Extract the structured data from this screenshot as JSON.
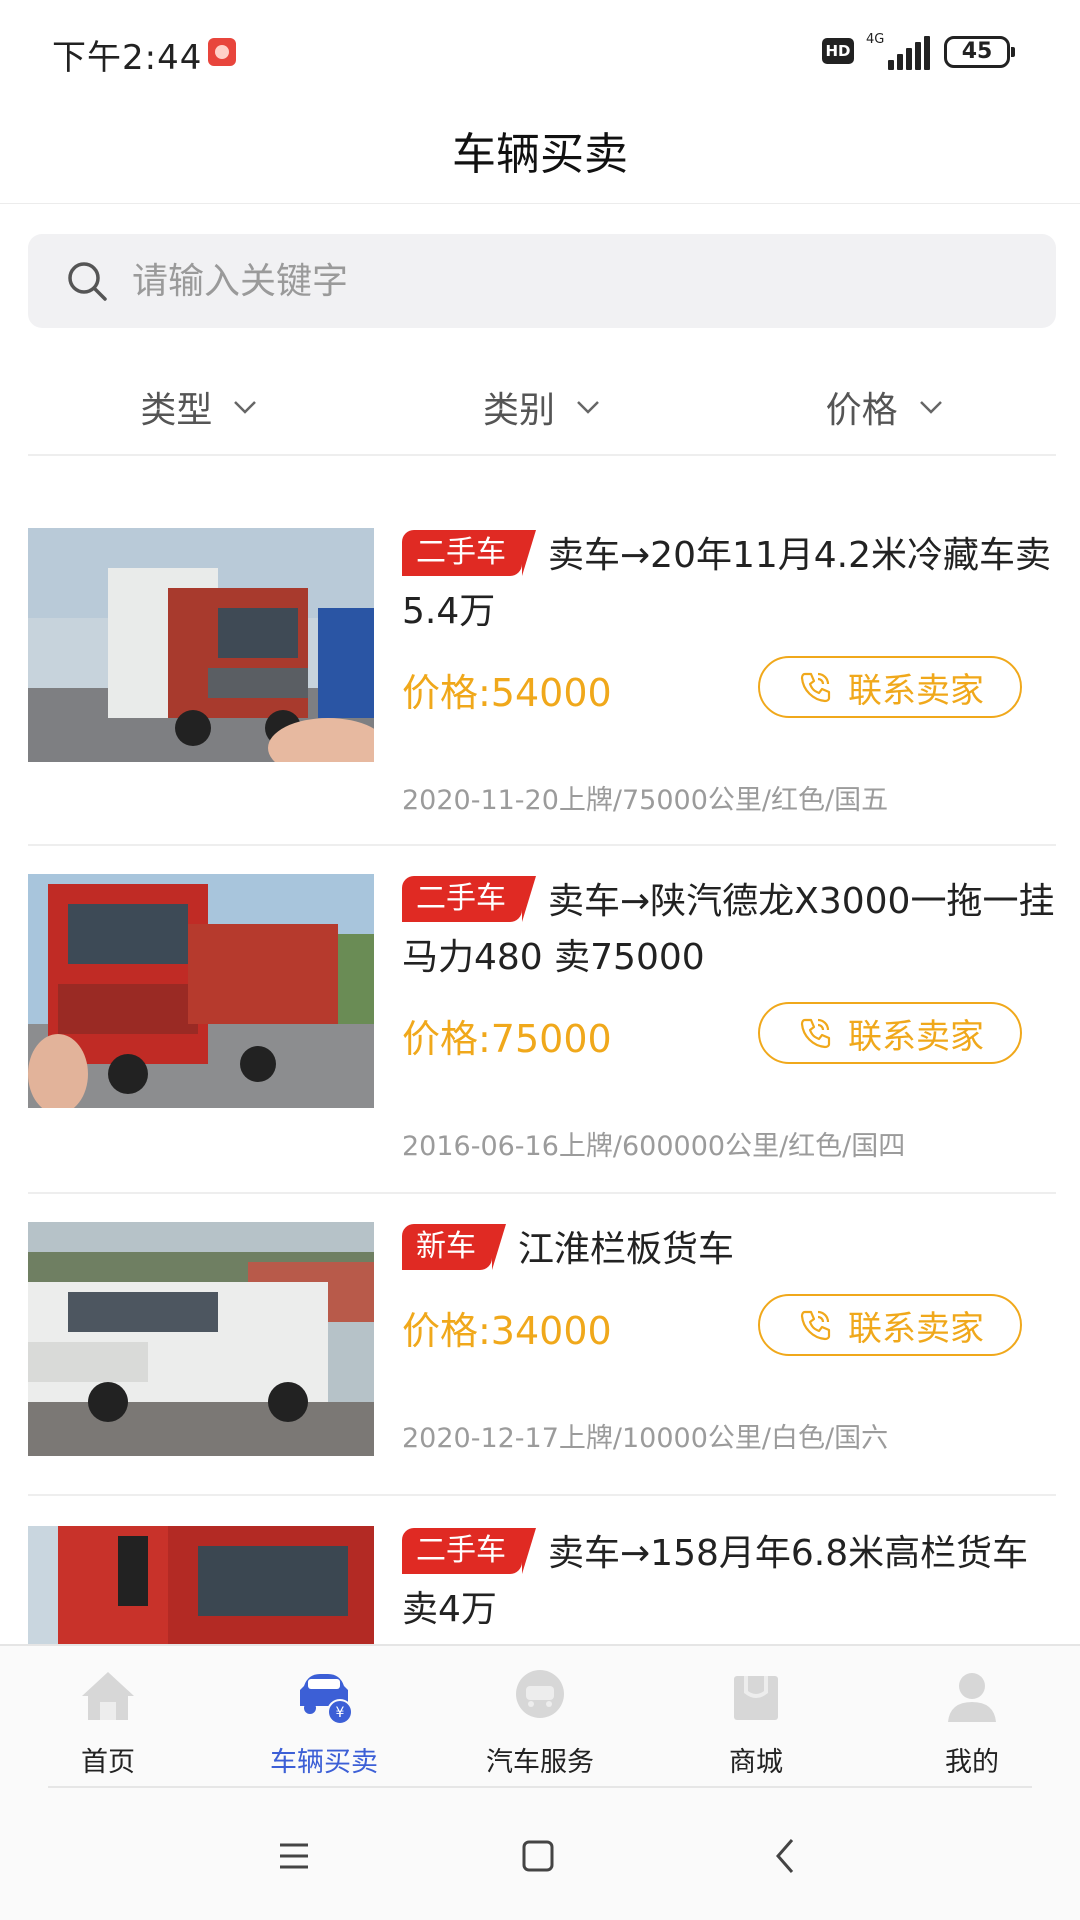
{
  "status_bar": {
    "time": "下午2:44",
    "network": "4G",
    "battery": "45",
    "hd_label": "HD"
  },
  "header": {
    "title": "车辆买卖"
  },
  "search": {
    "placeholder": "请输入关键字"
  },
  "filters": [
    {
      "label": "类型"
    },
    {
      "label": "类别"
    },
    {
      "label": "价格"
    }
  ],
  "listings": [
    {
      "tag": "二手车",
      "title": "卖车→20年11月4.2米冷藏车卖5.4万",
      "price": "价格:54000",
      "contact": "联系卖家",
      "meta": "2020-11-20上牌/75000公里/红色/国五"
    },
    {
      "tag": "二手车",
      "title": "卖车→陕汽德龙X3000一拖一挂 马力480 卖75000",
      "price": "价格:75000",
      "contact": "联系卖家",
      "meta": "2016-06-16上牌/600000公里/红色/国四"
    },
    {
      "tag": "新车",
      "title": "江淮栏板货车",
      "price": "价格:34000",
      "contact": "联系卖家",
      "meta": "2020-12-17上牌/10000公里/白色/国六"
    },
    {
      "tag": "二手车",
      "title": "卖车→158月年6.8米高栏货车卖4万"
    }
  ],
  "bottom_nav": [
    {
      "label": "首页",
      "icon": "home-icon",
      "active": false
    },
    {
      "label": "车辆买卖",
      "icon": "car-trade-icon",
      "active": true
    },
    {
      "label": "汽车服务",
      "icon": "car-service-icon",
      "active": false
    },
    {
      "label": "商城",
      "icon": "shop-icon",
      "active": false
    },
    {
      "label": "我的",
      "icon": "profile-icon",
      "active": false
    }
  ],
  "colors": {
    "accent_orange": "#f0a81b",
    "tag_red": "#e02a23",
    "active_blue": "#3c5fd6"
  }
}
